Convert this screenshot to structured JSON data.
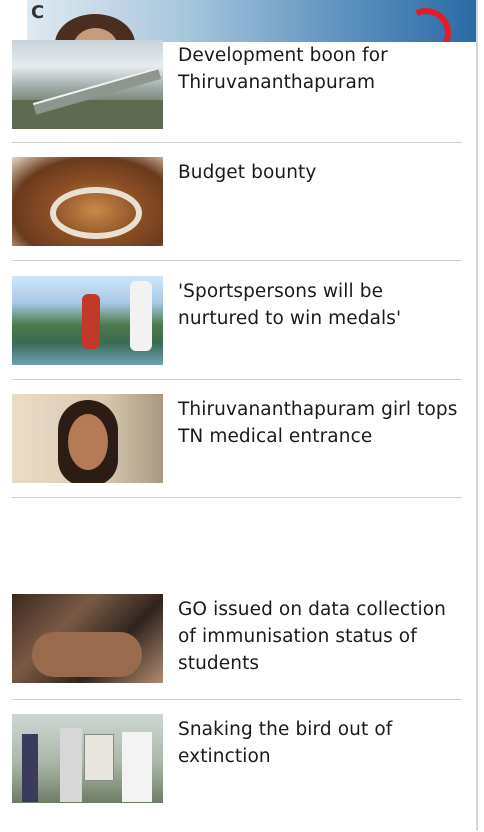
{
  "ad": {
    "refresh_symbol": "C"
  },
  "articles": [
    {
      "title": "Development boon for Thiruvananthapuram",
      "thumb_icon": "bridge-image"
    },
    {
      "title": "Budget bounty",
      "thumb_icon": "assembly-hall-image"
    },
    {
      "title": "'Sportspersons will be nurtured to win medals'",
      "thumb_icon": "runners-image"
    },
    {
      "title": "Thiruvananthapuram girl tops TN medical entrance",
      "thumb_icon": "portrait-image"
    },
    {
      "title": "GO issued on data collection of immunisation status of students",
      "thumb_icon": "vaccination-image"
    },
    {
      "title": "Snaking the bird out of extinction",
      "thumb_icon": "event-image"
    }
  ]
}
